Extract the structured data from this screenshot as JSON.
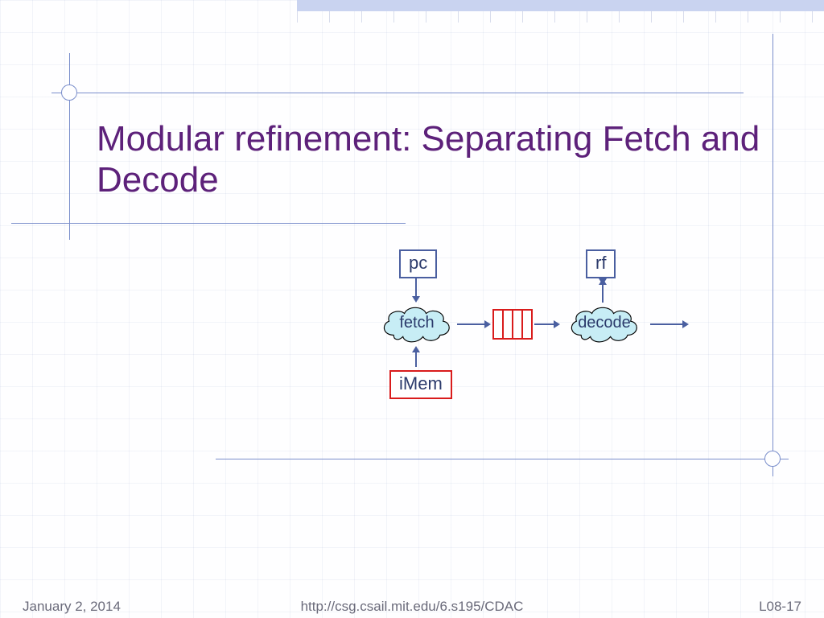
{
  "title": "Modular refinement: Separating Fetch and Decode",
  "diagram": {
    "pc_label": "pc",
    "rf_label": "rf",
    "fetch_label": "fetch",
    "decode_label": "decode",
    "imem_label": "iMem"
  },
  "footer": {
    "date": "January 2, 2014",
    "url": "http://csg.csail.mit.edu/6.s195/CDAC",
    "slide": "L08-17"
  },
  "colors": {
    "title": "#5d217a",
    "line_blue": "#4a5fa0",
    "accent_red": "#d91c1c",
    "cloud_fill": "#c7edf5"
  }
}
